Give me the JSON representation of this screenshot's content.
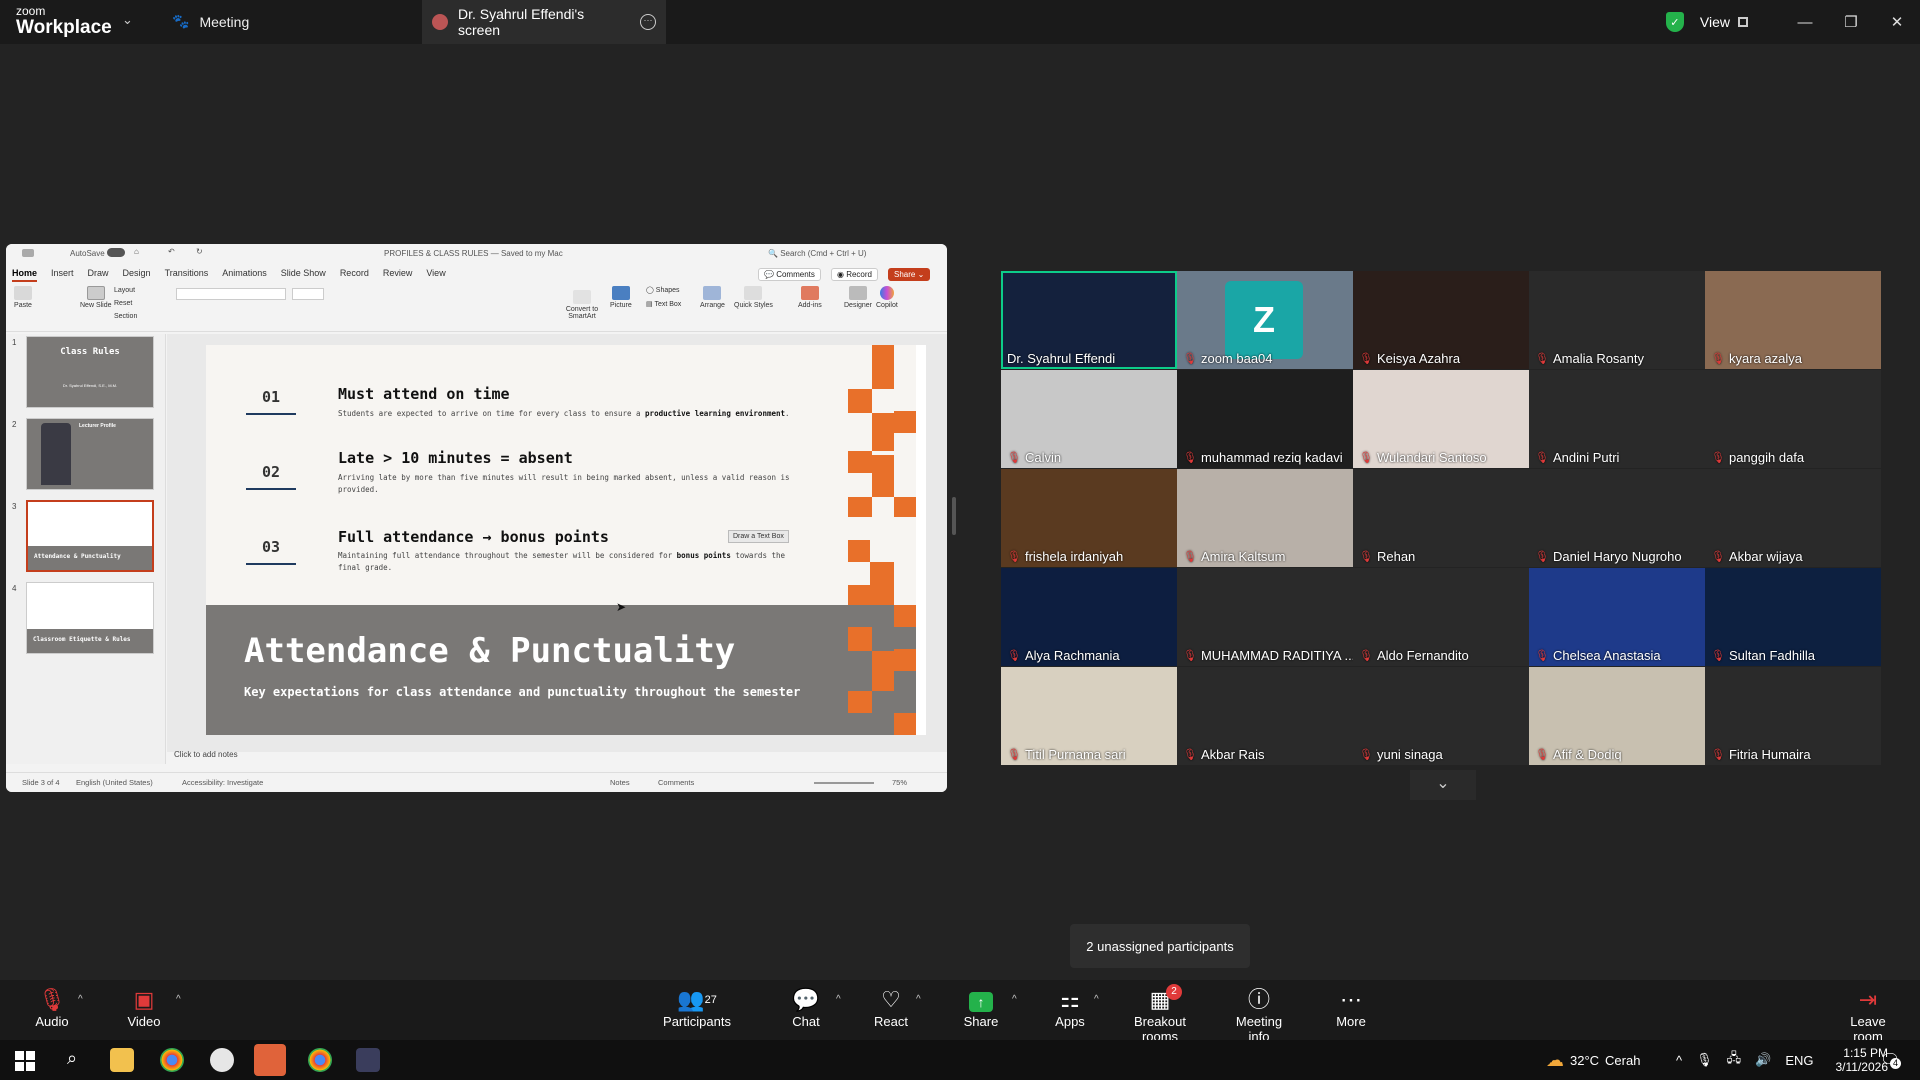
{
  "titlebar": {
    "logo_top": "zoom",
    "logo_bottom": "Workplace",
    "meeting": "Meeting",
    "screen_tab": "Dr. Syahrul Effendi's screen",
    "view": "View"
  },
  "ppt": {
    "doc_title": "PROFILES & CLASS RULES",
    "saved": "Saved to my Mac",
    "autosave": "AutoSave",
    "search": "Search (Cmd + Ctrl + U)",
    "tabs": [
      "Home",
      "Insert",
      "Draw",
      "Design",
      "Transitions",
      "Animations",
      "Slide Show",
      "Record",
      "Review",
      "View"
    ],
    "comments": "Comments",
    "record": "Record",
    "share": "Share",
    "ribbon": {
      "paste": "Paste",
      "new_slide": "New Slide",
      "layout": "Layout",
      "reset": "Reset",
      "section": "Section",
      "convert": "Convert to SmartArt",
      "picture": "Picture",
      "shapes": "Shapes",
      "text_box": "Text Box",
      "arrange": "Arrange",
      "quick_styles": "Quick Styles",
      "addins": "Add-ins",
      "designer": "Designer",
      "copilot": "Copilot"
    },
    "thumbs": [
      {
        "num": "1",
        "title": "Class Rules",
        "sub": "Dr. Syahrul Effendi, S.E., M.M."
      },
      {
        "num": "2",
        "title": "Lecturer Profile",
        "sub": ""
      },
      {
        "num": "3",
        "title": "Attendance & Punctuality",
        "sub": ""
      },
      {
        "num": "4",
        "title": "Classroom Etiquette & Rules",
        "sub": ""
      }
    ],
    "slide": {
      "rules": [
        {
          "num": "01",
          "heading": "Must attend on time",
          "desc_pre": "Students are expected to arrive on time for every class to ensure a ",
          "desc_bold": "productive learning environment",
          "desc_post": "."
        },
        {
          "num": "02",
          "heading": "Late > 10 minutes = absent",
          "desc_pre": "Arriving late by more than five minutes will result in being marked absent, unless a valid reason is provided.",
          "desc_bold": "",
          "desc_post": ""
        },
        {
          "num": "03",
          "heading": "Full attendance → bonus points",
          "desc_pre": "Maintaining full attendance throughout the semester will be considered for ",
          "desc_bold": "bonus points",
          "desc_post": " towards the final grade."
        }
      ],
      "draw_text_box": "Draw a Text Box",
      "title": "Attendance & Punctuality",
      "subtitle": "Key expectations for class attendance and punctuality throughout the semester"
    },
    "notes_placeholder": "Click to add notes",
    "status": {
      "slide": "Slide 3 of 4",
      "lang": "English (United States)",
      "access": "Accessibility: Investigate",
      "notes": "Notes",
      "comments": "Comments",
      "zoom": "75%"
    }
  },
  "participants_grid": [
    [
      "Dr. Syahrul Effendi",
      "zoom baa04",
      "Keisya Azahra",
      "Amalia Rosanty",
      "kyara azalya"
    ],
    [
      "Calvin",
      "muhammad reziq kadavi",
      "Wulandari Santoso",
      "Andini Putri",
      "panggih dafa"
    ],
    [
      "frishela irdaniyah",
      "Amira Kaltsum",
      "Rehan",
      "Daniel Haryo Nugroho",
      "Akbar wijaya"
    ],
    [
      "Alya Rachmania",
      "MUHAMMAD RADITIYA ...",
      "Aldo Fernandito",
      "Chelsea Anastasia",
      "Sultan Fadhilla"
    ],
    [
      "Titil Purnama sari",
      "Akbar Rais",
      "yuni sinaga",
      "Afif & Dodiq",
      "Fitria Humaira"
    ]
  ],
  "avatar_letter": "Z",
  "popup": "2 unassigned participants",
  "toolbar": {
    "audio": "Audio",
    "video": "Video",
    "participants": "Participants",
    "participant_count": "27",
    "chat": "Chat",
    "react": "React",
    "share": "Share",
    "apps": "Apps",
    "breakout": "Breakout rooms",
    "breakout_badge": "2",
    "info": "Meeting info",
    "more": "More",
    "leave": "Leave room"
  },
  "taskbar": {
    "weather": "32°C",
    "weather_desc": "Cerah",
    "lang": "ENG",
    "time": "1:15 PM",
    "date": "3/11/2026",
    "notif": "4"
  },
  "colors": {
    "accent_orange": "#e8702a",
    "zoom_green": "#0dcc8a",
    "mute_red": "#e03a3a",
    "share_green": "#24b24b"
  }
}
